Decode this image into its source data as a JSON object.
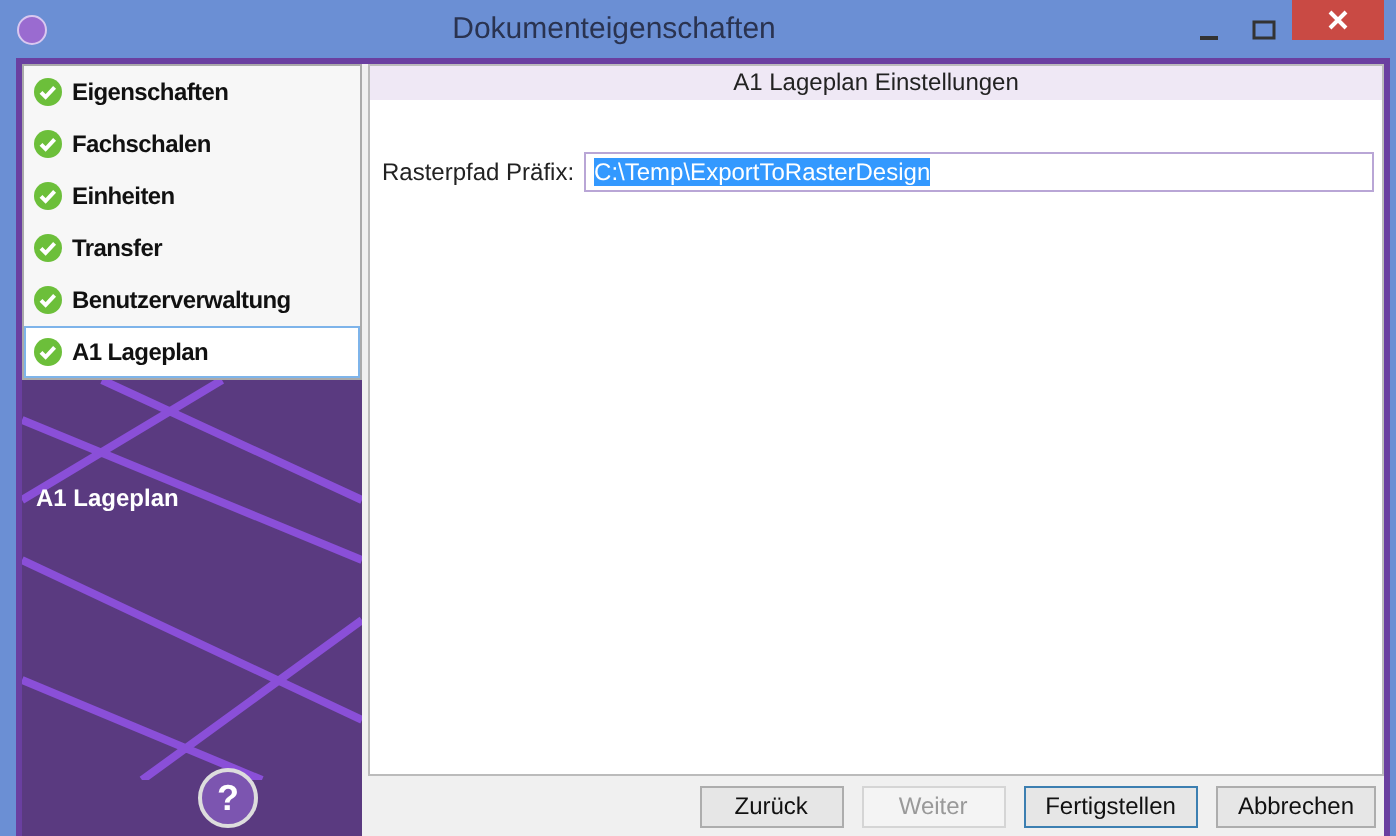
{
  "window": {
    "title": "Dokumenteigenschaften"
  },
  "sidebar": {
    "items": [
      {
        "label": "Eigenschaften",
        "selected": false
      },
      {
        "label": "Fachschalen",
        "selected": false
      },
      {
        "label": "Einheiten",
        "selected": false
      },
      {
        "label": "Transfer",
        "selected": false
      },
      {
        "label": "Benutzerverwaltung",
        "selected": false
      },
      {
        "label": "A1 Lageplan",
        "selected": true
      }
    ],
    "banner_title": "A1 Lageplan",
    "help_button": "?"
  },
  "panel": {
    "title": "A1 Lageplan Einstellungen",
    "field_label": "Rasterpfad Präfix:",
    "field_value": "C:\\Temp\\ExportToRasterDesign"
  },
  "buttons": [
    {
      "label": "Zurück",
      "disabled": false,
      "focused": false
    },
    {
      "label": "Weiter",
      "disabled": true,
      "focused": false
    },
    {
      "label": "Fertigstellen",
      "disabled": false,
      "focused": true
    },
    {
      "label": "Abbrechen",
      "disabled": false,
      "focused": false
    }
  ]
}
